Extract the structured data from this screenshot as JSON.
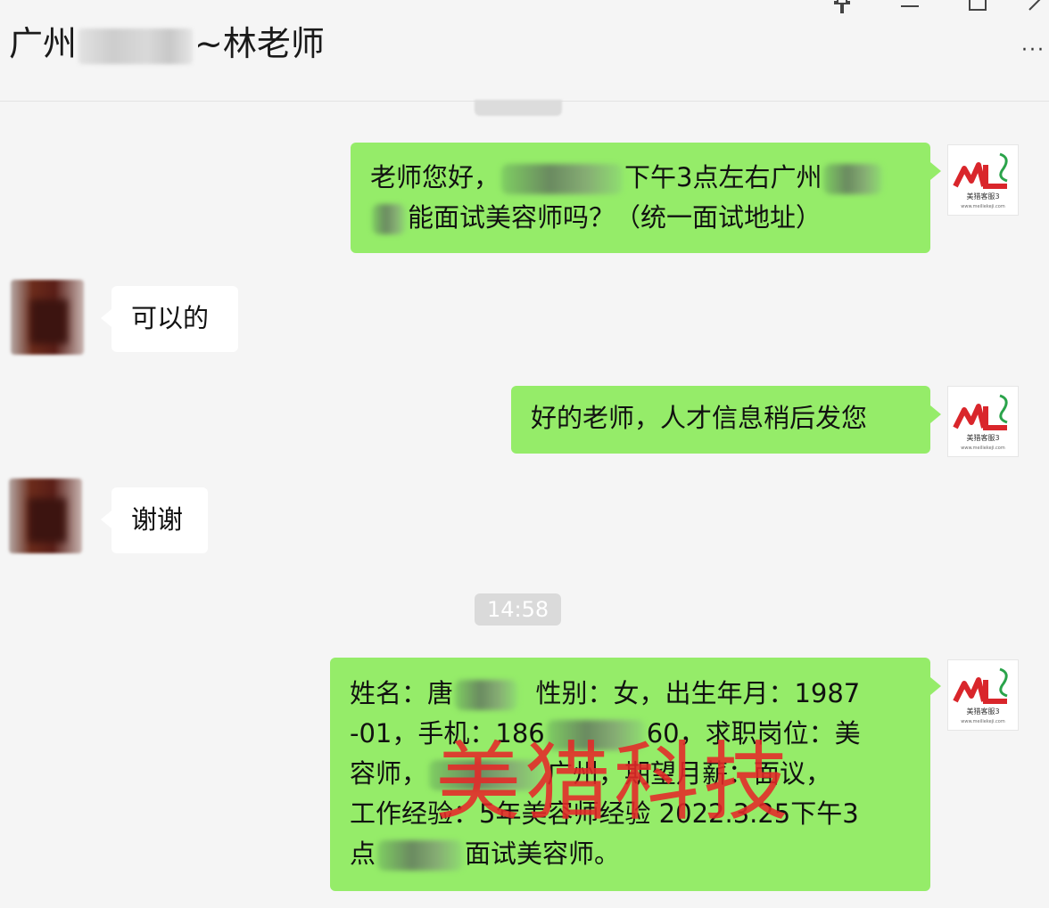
{
  "window": {
    "title_prefix": "广州",
    "title_suffix": "~林老师",
    "pin_icon": "pin-icon",
    "minimize_icon": "minimize-icon",
    "maximize_icon": "maximize-icon",
    "close_icon": "close-icon",
    "more_label": "···"
  },
  "timestamps": {
    "second": "14:58"
  },
  "messages": [
    {
      "from": "self",
      "part1": "老师您好，",
      "part2": "下午3点左右广州",
      "part3": "能面试美容师吗？（统一面试地址）"
    },
    {
      "from": "other",
      "text": "可以的"
    },
    {
      "from": "self",
      "text": "好的老师，人才信息稍后发您"
    },
    {
      "from": "other",
      "text": "谢谢"
    },
    {
      "from": "self",
      "line1a": "姓名：唐",
      "line1b": "性别：女，出生年月：1987",
      "line2a": "-01，手机：186",
      "line2b": "60，求职岗位：美",
      "line3a": "容师，",
      "line3b": "广州，期望月薪：面议，",
      "line4": "工作经验：5年美容师经验 2022.3.25下午3",
      "line5a": "点",
      "line5b": "面试美容师。"
    }
  ],
  "watermark": "美猎科技",
  "self_avatar": {
    "logo_text": "美猎客服3",
    "url_text": "www.meiliekeji.com"
  },
  "colors": {
    "self_bubble": "#95ec69",
    "other_bubble": "#ffffff",
    "background": "#f5f5f5",
    "watermark": "#e52828"
  }
}
